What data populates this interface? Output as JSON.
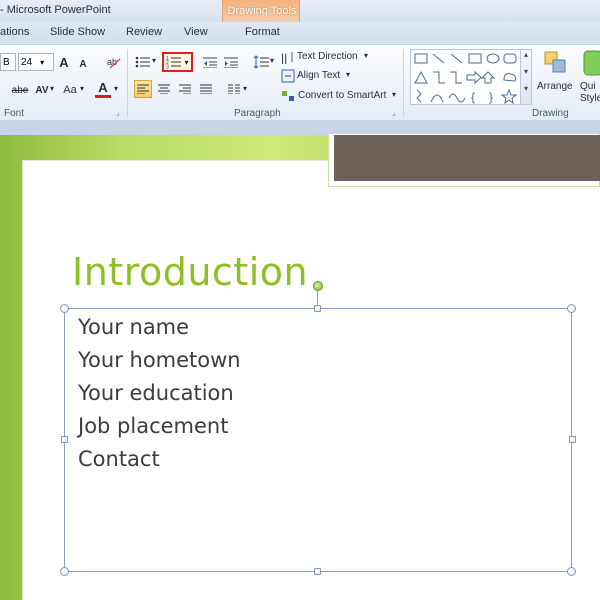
{
  "window": {
    "title": "- Microsoft PowerPoint",
    "context_tab_group": "Drawing Tools"
  },
  "tabs": [
    "ations",
    "Slide Show",
    "Review",
    "View",
    "Format"
  ],
  "ribbon": {
    "font_group": {
      "label": "Font",
      "font_name_partial": "B",
      "font_size": "24",
      "grow_font": "A",
      "shrink_font": "A",
      "strikethrough": "abe",
      "char_spacing": "AV",
      "change_case": "Aa",
      "font_color": "A"
    },
    "paragraph_group": {
      "label": "Paragraph",
      "text_direction": "Text Direction",
      "align_text": "Align Text",
      "convert_smartart": "Convert to SmartArt"
    },
    "drawing_group": {
      "label": "Drawing",
      "arrange": "Arrange",
      "quick_styles": "Qui\nStyle"
    }
  },
  "slide": {
    "title": "Introduction",
    "bullets": [
      "Your name",
      "Your hometown",
      "Your education",
      "Job placement",
      "Contact"
    ]
  },
  "colors": {
    "title_green": "#8fbf26",
    "slide_bg": "#b9dc66",
    "accent_box": "#6e625a",
    "highlight": "#e02020"
  }
}
